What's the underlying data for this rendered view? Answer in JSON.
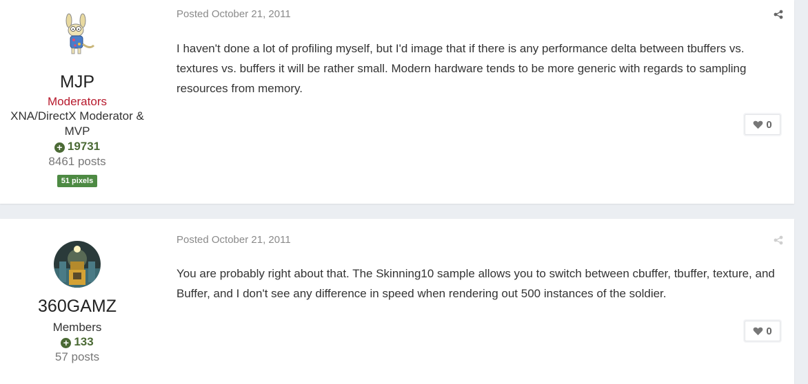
{
  "posts": [
    {
      "author": {
        "username": "MJP",
        "group": "Moderators",
        "group_color": "#b7192c",
        "title": "XNA/DirectX Moderator & MVP",
        "reputation": "19731",
        "post_count": "8461 posts",
        "badge": "51 pixels"
      },
      "date": "Posted October 21, 2011",
      "content": "I haven't done a lot of profiling myself, but I'd image that if there is any performance delta between tbuffers vs. textures vs. buffers it will be rather small. Modern hardware tends to be more generic with regards to sampling resources from memory.",
      "reaction_count": "0"
    },
    {
      "author": {
        "username": "360GAMZ",
        "group": "Members",
        "group_color": "#333333",
        "reputation": "133",
        "post_count": "57 posts"
      },
      "date": "Posted October 21, 2011",
      "content": "You are probably right about that. The Skinning10 sample allows you to switch between cbuffer, tbuffer, texture, and Buffer, and I don't see any difference in speed when rendering out 500 instances of the soldier.",
      "reaction_count": "0"
    }
  ],
  "colors": {
    "reputation_green": "#4b6a35",
    "badge_green": "#4d8a43",
    "page_background": "#ebeef2"
  }
}
